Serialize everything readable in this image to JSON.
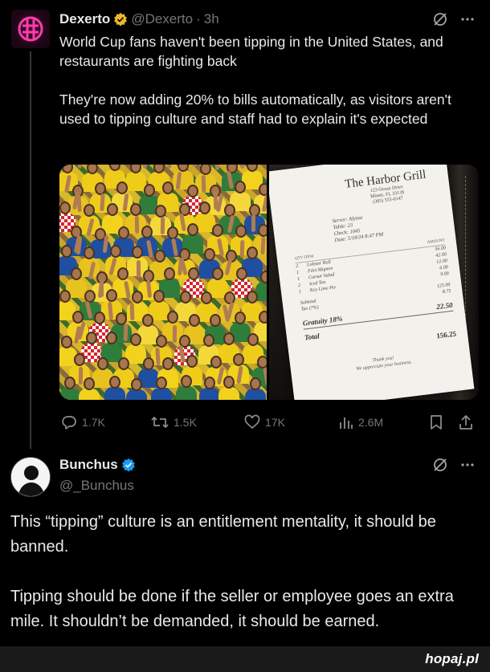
{
  "post": {
    "author_name": "Dexerto",
    "author_handle": "@Dexerto",
    "separator": "·",
    "time": "3h",
    "paragraphs": [
      "World Cup fans haven't been tipping in the United States, and restaurants are fighting back",
      "They're now adding 20% to bills automatically, as visitors aren't used to tipping culture and staff had to explain it's expected"
    ],
    "avatar_icon": "dexerto-logo-icon",
    "stats": {
      "replies": "1.7K",
      "reposts": "1.5K",
      "likes": "17K",
      "views": "2.6M"
    }
  },
  "receipt": {
    "restaurant": "The Harbor Grill",
    "address_lines": [
      "123 Ocean Drive",
      "Miami, FL 33139",
      "(305) 555-0147"
    ],
    "meta_lines": [
      "Server:   Alyssa",
      "Table:   23",
      "Check:   1045",
      "Date:   5/18/24   8:47 PM"
    ],
    "columns": {
      "left": "QTY   ITEM",
      "right": "AMOUNT"
    },
    "items": [
      {
        "qty": "2",
        "name": "Lobster Roll",
        "amount": "56.00"
      },
      {
        "qty": "1",
        "name": "Filet Mignon",
        "amount": "42.00"
      },
      {
        "qty": "1",
        "name": "Caesar Salad",
        "amount": "12.00"
      },
      {
        "qty": "2",
        "name": "Iced Tea",
        "amount": "6.00"
      },
      {
        "qty": "1",
        "name": "Key Lime Pie",
        "amount": "9.00"
      }
    ],
    "subtotal_label": "Subtotal",
    "subtotal": "125.00",
    "tax_label": "Tax (7%)",
    "tax": "8.75",
    "gratuity_label": "Gratuity 18%",
    "gratuity": "22.50",
    "total_label": "Total",
    "total": "156.25",
    "thanks_lines": [
      "Thank you!",
      "We appreciate your business."
    ]
  },
  "reply": {
    "author_name": "Bunchus",
    "author_handle": "@_Bunchus",
    "paragraphs": [
      "This “tipping” culture is an entitlement mentality, it should be banned.",
      "Tipping should be done if the seller or employee goes an extra mile. It shouldn’t be demanded, it should be earned."
    ]
  },
  "watermark": "hopaj.pl",
  "colors": {
    "background": "#000000",
    "text": "#e7e9ea",
    "muted": "#71767b",
    "verified_badge": "#e8b92a",
    "verified_blue": "#1d9bf0"
  }
}
